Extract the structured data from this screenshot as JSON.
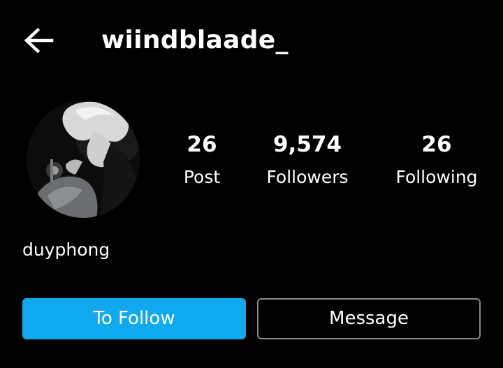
{
  "header": {
    "back_icon": "arrow-left-icon",
    "username": "wiindblaade_"
  },
  "profile": {
    "avatar_description_icon": "profile-photo",
    "display_name": "duyphong"
  },
  "stats": {
    "posts": {
      "value": "26",
      "label": "Post"
    },
    "followers": {
      "value": "9,574",
      "label": "Followers"
    },
    "following": {
      "value": "26",
      "label": "Following"
    }
  },
  "actions": {
    "follow_label": "To Follow",
    "message_label": "Message"
  },
  "colors": {
    "background": "#000000",
    "text": "#ffffff",
    "accent": "#0fa9ef",
    "outline": "#8a8a8a"
  }
}
